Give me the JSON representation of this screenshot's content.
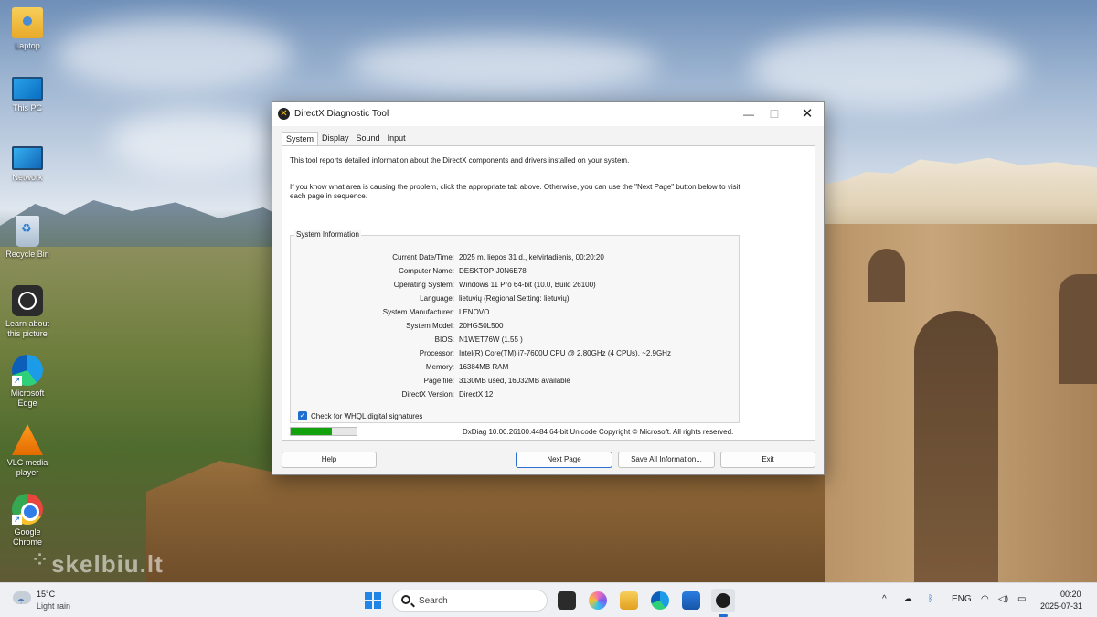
{
  "desktop": {
    "icons": [
      {
        "label": "Laptop",
        "icon": "folder-icon",
        "shortcut": false
      },
      {
        "label": "This PC",
        "icon": "monitor-icon",
        "shortcut": false
      },
      {
        "label": "Network",
        "icon": "network-icon",
        "shortcut": false
      },
      {
        "label": "Recycle Bin",
        "icon": "recycle-bin-icon",
        "shortcut": false
      },
      {
        "label": "Learn about this picture",
        "icon": "learn-icon",
        "shortcut": false
      },
      {
        "label": "Microsoft Edge",
        "icon": "edge-icon",
        "shortcut": true
      },
      {
        "label": "VLC media player",
        "icon": "vlc-icon",
        "shortcut": true
      },
      {
        "label": "Google Chrome",
        "icon": "chrome-icon",
        "shortcut": true
      }
    ],
    "watermark": "skelbiu.lt",
    "shortcut_glyph": "↗"
  },
  "window": {
    "title": "DirectX Diagnostic Tool",
    "title_glyph": "✕",
    "controls": {
      "minimize": "—",
      "maximize": "☐",
      "close": "✕"
    },
    "tabs": [
      "System",
      "Display",
      "Sound",
      "Input"
    ],
    "active_tab": "System",
    "intro_line1": "This tool reports detailed information about the DirectX components and drivers installed on your system.",
    "intro_line2": "If you know what area is causing the problem, click the appropriate tab above.  Otherwise, you can use the \"Next Page\" button below to visit each page in sequence.",
    "group_title": "System Information",
    "info": [
      {
        "label": "Current Date/Time:",
        "value": "2025 m. liepos 31 d., ketvirtadienis, 00:20:20"
      },
      {
        "label": "Computer Name:",
        "value": "DESKTOP-J0N6E78"
      },
      {
        "label": "Operating System:",
        "value": "Windows 11 Pro 64-bit (10.0, Build 26100)"
      },
      {
        "label": "Language:",
        "value": "lietuvių (Regional Setting: lietuvių)"
      },
      {
        "label": "System Manufacturer:",
        "value": "LENOVO"
      },
      {
        "label": "System Model:",
        "value": "20HGS0L500"
      },
      {
        "label": "BIOS:",
        "value": "N1WET76W (1.55 )"
      },
      {
        "label": "Processor:",
        "value": "Intel(R) Core(TM) i7-7600U CPU @ 2.80GHz (4 CPUs), ~2.9GHz"
      },
      {
        "label": "Memory:",
        "value": "16384MB RAM"
      },
      {
        "label": "Page file:",
        "value": "3130MB used, 16032MB available"
      },
      {
        "label": "DirectX Version:",
        "value": "DirectX 12"
      }
    ],
    "whql_label": "Check for WHQL digital signatures",
    "whql_checked": true,
    "checkbox_glyph": "✓",
    "progress": 0.62,
    "footer": "DxDiag 10.00.26100.4484 64-bit Unicode  Copyright © Microsoft. All rights reserved.",
    "buttons": {
      "help": "Help",
      "next_page": "Next Page",
      "save_all": "Save All Information...",
      "exit": "Exit"
    }
  },
  "taskbar": {
    "weather_temp": "15°C",
    "weather_desc": "Light rain",
    "search_text": "Search",
    "tray_chevron": "^",
    "language": "ENG",
    "clock_time": "00:20",
    "clock_date": "2025-07-31"
  },
  "colors": {
    "accent": "#1f6fd1",
    "progress": "#13a10e"
  }
}
